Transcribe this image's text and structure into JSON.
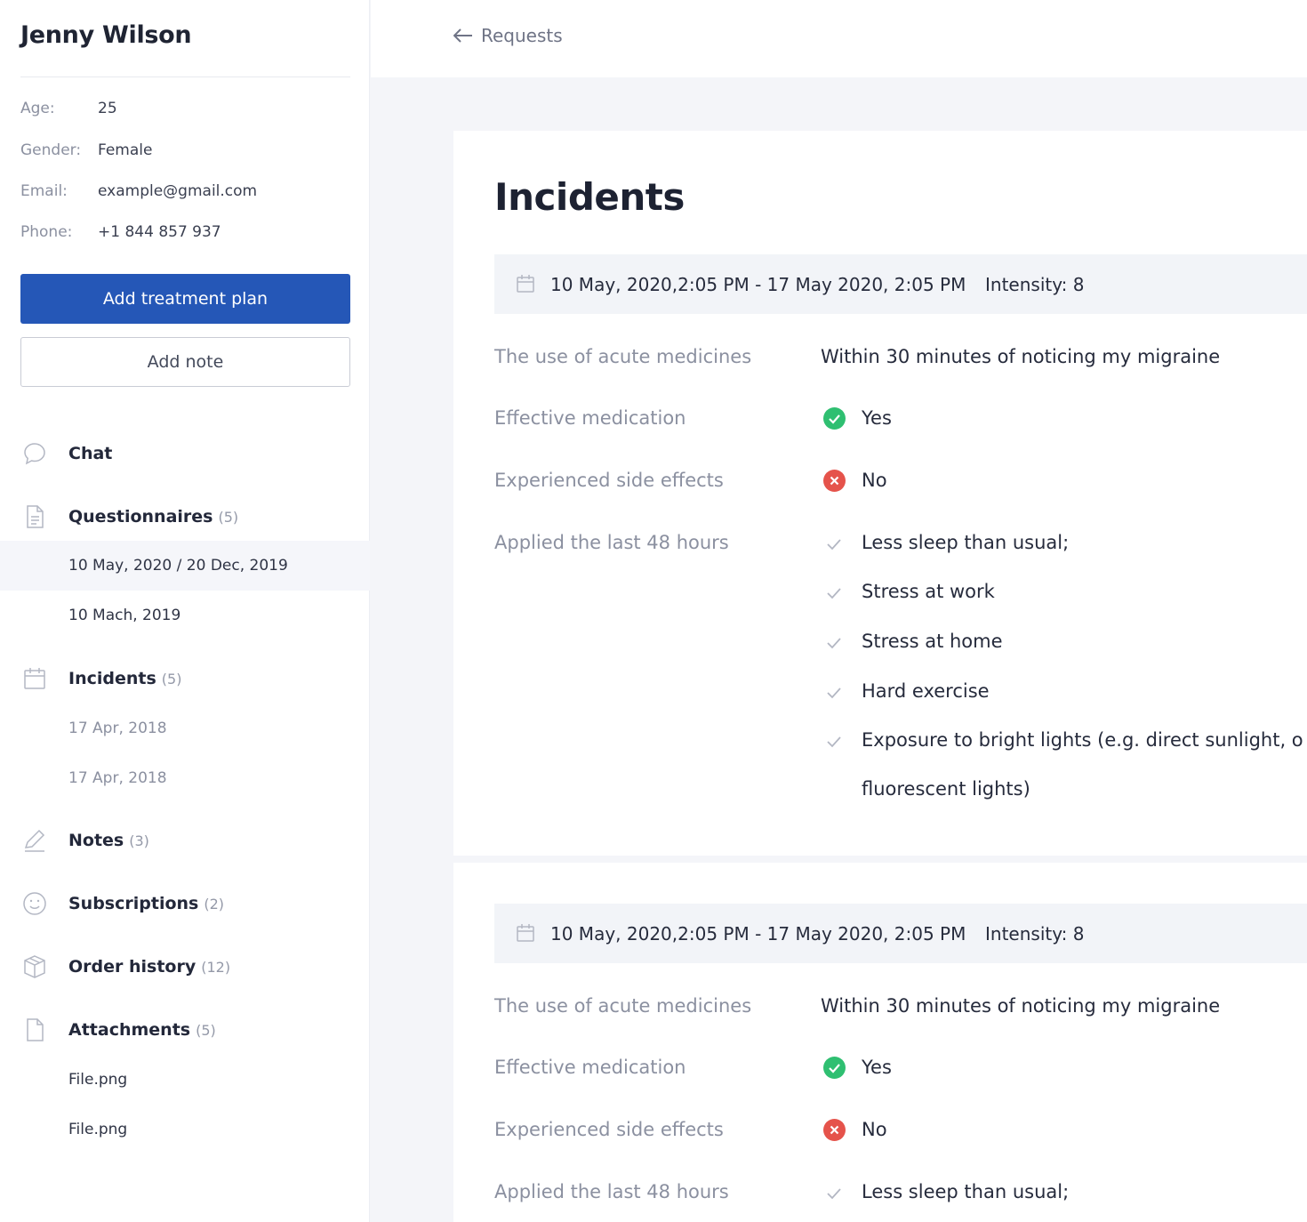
{
  "patient": {
    "name": "Jenny Wilson",
    "info": [
      {
        "label": "Age:",
        "value": "25"
      },
      {
        "label": "Gender:",
        "value": "Female"
      },
      {
        "label": "Email:",
        "value": "example@gmail.com"
      },
      {
        "label": "Phone:",
        "value": "+1 844 857 937"
      }
    ]
  },
  "actions": {
    "add_treatment_plan": "Add treatment plan",
    "add_note": "Add note"
  },
  "nav": {
    "chat": {
      "label": "Chat",
      "icon": "chat-bubble-icon"
    },
    "questionnaires": {
      "label": "Questionnaires",
      "count": "(5)",
      "icon": "document-icon",
      "items": [
        "10 May, 2020 / 20 Dec, 2019",
        "10 Mach, 2019"
      ]
    },
    "incidents": {
      "label": "Incidents",
      "count": "(5)",
      "icon": "calendar-icon",
      "items": [
        "17 Apr, 2018",
        "17 Apr, 2018"
      ]
    },
    "notes": {
      "label": "Notes",
      "count": "(3)",
      "icon": "pencil-icon"
    },
    "subscriptions": {
      "label": "Subscriptions",
      "count": "(2)",
      "icon": "smiley-icon"
    },
    "order_history": {
      "label": "Order history",
      "count": "(12)",
      "icon": "box-icon"
    },
    "attachments": {
      "label": "Attachments",
      "count": "(5)",
      "icon": "file-icon",
      "items": [
        "File.png",
        "File.png"
      ]
    }
  },
  "topbar": {
    "back_label": "Requests"
  },
  "main": {
    "title": "Incidents",
    "incidents": [
      {
        "dates": "10 May, 2020,2:05 PM - 17 May 2020, 2:05 PM",
        "intensity": "Intensity: 8",
        "fields": {
          "acute_label": "The use of acute medicines",
          "acute_value": "Within 30 minutes of noticing my migraine",
          "effective_label": "Effective medication",
          "effective_value": "Yes",
          "side_effects_label": "Experienced side effects",
          "side_effects_value": "No",
          "applied_label": "Applied the last 48 hours"
        },
        "triggers": [
          "Less sleep than usual;",
          "Stress at work",
          "Stress at home",
          "Hard exercise",
          "Exposure to bright lights (e.g. direct sunlight, o",
          "fluorescent lights)"
        ]
      },
      {
        "dates": "10 May, 2020,2:05 PM - 17 May 2020, 2:05 PM",
        "intensity": "Intensity: 8",
        "fields": {
          "acute_label": "The use of acute medicines",
          "acute_value": "Within 30 minutes of noticing my migraine",
          "effective_label": "Effective medication",
          "effective_value": "Yes",
          "side_effects_label": "Experienced side effects",
          "side_effects_value": "No",
          "applied_label": "Applied the last 48 hours"
        },
        "triggers": [
          "Less sleep than usual;"
        ]
      }
    ]
  },
  "colors": {
    "primary": "#2557b7",
    "success": "#2fbf71",
    "danger": "#e5534b",
    "muted": "#8b90a0"
  }
}
